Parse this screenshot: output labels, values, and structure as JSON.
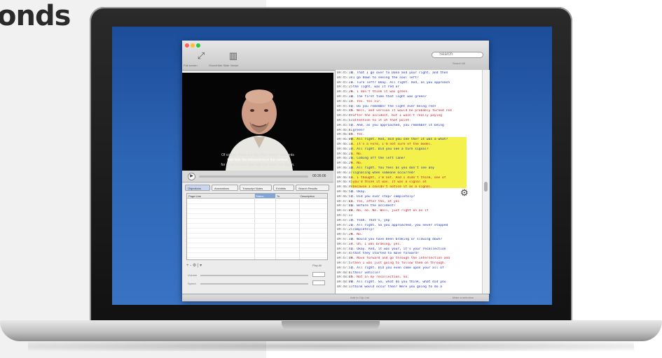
{
  "headline": "onds",
  "app": {
    "toolbar": {
      "tools": [
        {
          "icon": "expand-arrows-icon",
          "glyph": "⤢",
          "label": "Full screen"
        },
        {
          "icon": "filmstrip-icon",
          "glyph": "▥",
          "label": "Show/Hide Slide Viewer"
        }
      ],
      "search_placeholder": "Search",
      "search_sub": "Search All"
    },
    "video": {
      "subtitles": [
        "Of course, there are the other sensor elements",
        "that hide the interactions in the context,",
        "for an on-screen slide with the outer key ring in."
      ]
    },
    "player": {
      "play_glyph": "▶",
      "timecode": "00:26:06"
    },
    "tabs": [
      {
        "label": "Objections",
        "selected": true
      },
      {
        "label": "Annotations",
        "selected": false
      },
      {
        "label": "Transcript Notes",
        "selected": false
      },
      {
        "label": "Exhibits",
        "selected": false
      },
      {
        "label": "Search Results",
        "selected": false
      }
    ],
    "table": {
      "headers": [
        "Page:Line",
        "Status",
        "To",
        "Description"
      ],
      "selected_header": 1,
      "rows": 12
    },
    "table_tools": "+  -  ⚙  |  ▾",
    "table_tools_right": "Play All",
    "sliders": [
      {
        "label": "Volume"
      },
      {
        "label": "Speed"
      }
    ],
    "transcript": {
      "lines": [
        {
          "tc": "09:45:14",
          "type": "q",
          "text": "Q.  That I go over to Dana and your right, and then"
        },
        {
          "tc": "09:45:18",
          "type": "q",
          "text": "   I go down to seeing the soul left?"
        },
        {
          "tc": "09:45:22",
          "type": "q",
          "text": "A.  Turn left? Okay. All right. And, as you approach"
        },
        {
          "tc": "09:45:25",
          "type": "q",
          "text": "   the light, was it red or"
        },
        {
          "tc": "09:45:29",
          "type": "a",
          "text": "A.  I don't think it was green."
        },
        {
          "tc": "09:45:33",
          "type": "q",
          "text": "Q.  The first time that light was green?"
        },
        {
          "tc": "09:45:37",
          "type": "a",
          "text": "A.  Yes. Yes sir."
        },
        {
          "tc": "09:45:41",
          "type": "q",
          "text": "Q.  Do you remember the light ever being red?"
        },
        {
          "tc": "09:45:45",
          "type": "a",
          "text": "A.  Well, and version it would be probably turned red"
        },
        {
          "tc": "09:45:49",
          "type": "a",
          "text": "   after the accident, but I wasn't really paying"
        },
        {
          "tc": "09:45:53",
          "type": "a",
          "text": "   attention to it at that point."
        },
        {
          "tc": "09:45:57",
          "type": "q",
          "text": "Q.  And, as you approached, you remember it being"
        },
        {
          "tc": "09:46:01",
          "type": "q",
          "text": "   green?"
        },
        {
          "tc": "09:46:05",
          "type": "a",
          "text": "A.  Yes."
        },
        {
          "tc": "09:46:09",
          "type": "q",
          "text": "Q.  All right. And, did you see the? It was a what?"
        },
        {
          "tc": "09:46:13",
          "type": "a",
          "text": "A.  It's a Ford, I'm not sure of the model."
        },
        {
          "tc": "09:46:17",
          "type": "q",
          "text": "Q.  All right. Did you see a turn signal?"
        },
        {
          "tc": "09:46:21",
          "type": "a",
          "text": "A.  No."
        },
        {
          "tc": "09:46:25",
          "type": "q",
          "text": "Q.  Coming off the left lane?"
        },
        {
          "tc": "09:46:29",
          "type": "a",
          "text": "A.  No."
        },
        {
          "tc": "09:46:33",
          "type": "q",
          "text": "Q.  All right. You feel as you don't see any"
        },
        {
          "tc": "09:46:37",
          "type": "q",
          "text": "   signaling when someone occurred?"
        },
        {
          "tc": "09:46:41",
          "type": "a",
          "text": "A.  I thought, I'm not. And I didn't think, one of"
        },
        {
          "tc": "09:46:45",
          "type": "a",
          "text": "   you'd think it was. It was a signal at"
        },
        {
          "tc": "09:46:49",
          "type": "a",
          "text": "   because I couldn't notice it as a signal."
        },
        {
          "tc": "09:46:53",
          "type": "q",
          "text": "Q.  Okay."
        },
        {
          "tc": "09:46:57",
          "type": "q",
          "text": "Q.  Did you ever stop? completely?"
        },
        {
          "tc": "09:47:01",
          "type": "a",
          "text": "A.  Yes, after the, at yes"
        },
        {
          "tc": "09:47:05",
          "type": "q",
          "text": "Q.  Before the accident?"
        },
        {
          "tc": "09:47:09",
          "type": "a",
          "text": "A.  No, no. No. Well, just right on as it"
        },
        {
          "tc": "09:47:13",
          "type": "q",
          "text": ""
        },
        {
          "tc": "09:47:17",
          "type": "q",
          "text": "Q.  Yeah. That's, yep"
        },
        {
          "tc": "09:47:21",
          "type": "q",
          "text": "Q.  All right. So you approached, you never stopped"
        },
        {
          "tc": "09:47:25",
          "type": "q",
          "text": "   completely?"
        },
        {
          "tc": "09:47:29",
          "type": "a",
          "text": "A.  No."
        },
        {
          "tc": "09:47:33",
          "type": "q",
          "text": "Q.  Would you have been braking or slowing down?"
        },
        {
          "tc": "09:47:37",
          "type": "a",
          "text": "A.  Oh, I was braking, yes."
        },
        {
          "tc": "09:47:41",
          "type": "q",
          "text": "Q.  Okay. And, it was your, it's your recollection"
        },
        {
          "tc": "09:47:45",
          "type": "q",
          "text": "   that they started to move forward?"
        },
        {
          "tc": "09:47:49",
          "type": "a",
          "text": "A.  Move forward and go through the intersection and"
        },
        {
          "tc": "09:47:53",
          "type": "a",
          "text": "   then I was just going to follow them on through."
        },
        {
          "tc": "09:47:57",
          "type": "q",
          "text": "Q.  All right. Did you even come upon your all of"
        },
        {
          "tc": "09:48:01",
          "type": "q",
          "text": "   their vehicle?"
        },
        {
          "tc": "09:48:05",
          "type": "a",
          "text": "A.  Not in my recollection, no."
        },
        {
          "tc": "09:48:09",
          "type": "q",
          "text": "Q.  All right. So, what do you think, what did you"
        },
        {
          "tc": "09:48:13",
          "type": "q",
          "text": "   think would occur then? Were you going to do a"
        }
      ]
    },
    "status": {
      "left": "Add to Clip List",
      "right": "Make a selection"
    },
    "colors": {
      "question": "#1a2fb8",
      "answer": "#c2182c",
      "highlight": "#f3ef3a"
    }
  }
}
